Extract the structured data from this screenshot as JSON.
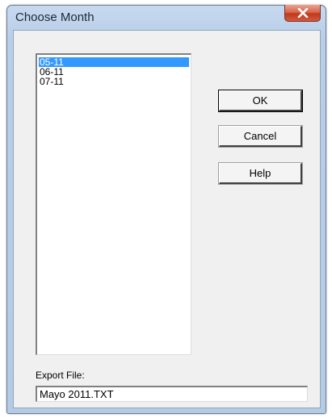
{
  "window": {
    "title": "Choose Month"
  },
  "months": {
    "items": [
      "05-11",
      "06-11",
      "07-11"
    ],
    "selected": "05-11"
  },
  "buttons": {
    "ok_label": "OK",
    "cancel_label": "Cancel",
    "help_label": "Help"
  },
  "export": {
    "label": "Export File:",
    "value": "Mayo 2011.TXT"
  },
  "icons": {
    "close": "close-icon"
  },
  "colors": {
    "selection": "#3399ff",
    "close_button": "#c2381c",
    "frame": "#b9cee8"
  }
}
